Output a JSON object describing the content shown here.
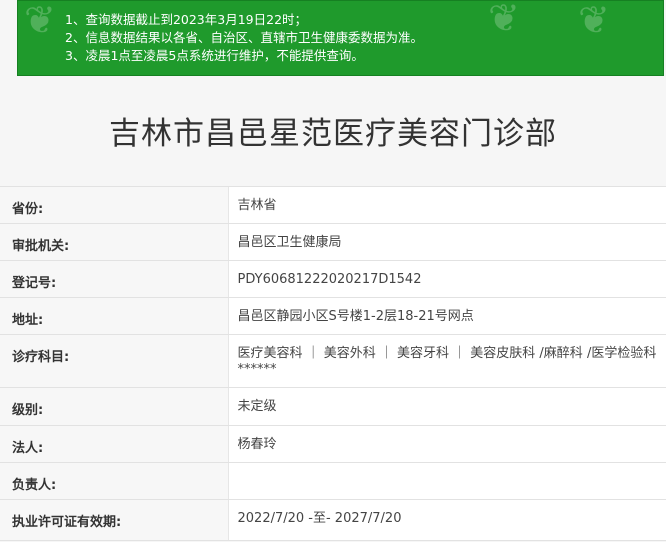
{
  "notice": {
    "lines": [
      "1、查询数据截止到2023年3月19日22时；",
      "2、信息数据结果以各省、自治区、直辖市卫生健康委数据为准。",
      "3、凌晨1点至凌晨5点系统进行维护，不能提供查询。"
    ],
    "background_color": "#1f9a2c"
  },
  "title": "吉林市昌邑星范医疗美容门诊部",
  "fields": [
    {
      "label": "省份:",
      "value": "吉林省"
    },
    {
      "label": "审批机关:",
      "value": "昌邑区卫生健康局"
    },
    {
      "label": "登记号:",
      "value": "PDY60681222020217D1542"
    },
    {
      "label": "地址:",
      "value": "昌邑区静园小区S号楼1-2层18-21号网点"
    },
    {
      "label": "诊疗科目:",
      "value_line1": "医疗美容科 ｜ 美容外科 ｜ 美容牙科 ｜ 美容皮肤科 /麻醉科 /医学检验科",
      "value_line2": "******"
    },
    {
      "label": "级别:",
      "value": "未定级"
    },
    {
      "label": "法人:",
      "value": "杨春玲"
    },
    {
      "label": "负责人:",
      "value": ""
    },
    {
      "label": "执业许可证有效期:",
      "value": "2022/7/20 -至- 2027/7/20"
    }
  ]
}
